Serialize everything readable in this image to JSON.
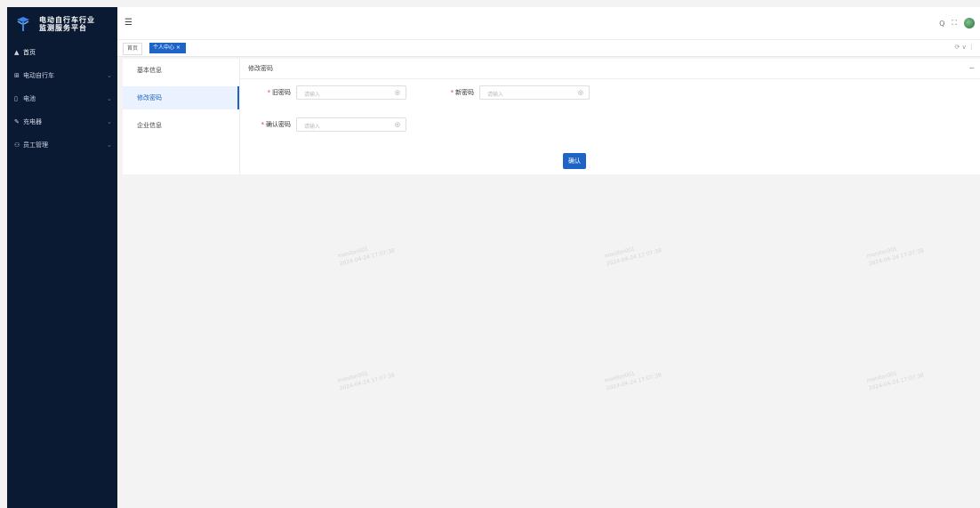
{
  "sidebar": {
    "title_line1": "电动自行车行业",
    "title_line2": "监测服务平台",
    "items": [
      {
        "icon": "home-icon",
        "label": "首页",
        "has_arrow": false
      },
      {
        "icon": "grid-icon",
        "label": "电动自行车",
        "has_arrow": true
      },
      {
        "icon": "battery-icon",
        "label": "电池",
        "has_arrow": true
      },
      {
        "icon": "wrench-icon",
        "label": "充电器",
        "has_arrow": true
      },
      {
        "icon": "users-icon",
        "label": "员工管理",
        "has_arrow": true
      }
    ]
  },
  "tabs": {
    "home": "首页",
    "current": "个人中心 ×"
  },
  "header_right": {
    "search": "Q",
    "fullscreen": "⛶",
    "tab_controls": "⟳ ∨ ⋮"
  },
  "left_nav": {
    "items": [
      "基本信息",
      "修改密码",
      "企业信息"
    ],
    "active_index": 1
  },
  "panel": {
    "title": "修改密码",
    "collapse": "−",
    "fields": [
      {
        "label": "旧密码",
        "placeholder": "请输入",
        "required": true
      },
      {
        "label": "新密码",
        "placeholder": "请输入",
        "required": true
      },
      {
        "label": "确认密码",
        "placeholder": "请输入",
        "required": true
      }
    ],
    "confirm_label": "确认"
  },
  "watermark": {
    "line1": "monitor001",
    "line2": "2024-04-24 17:07:38"
  },
  "colors": {
    "sidebar_bg": "#0b1a33",
    "accent": "#1e63c6"
  }
}
